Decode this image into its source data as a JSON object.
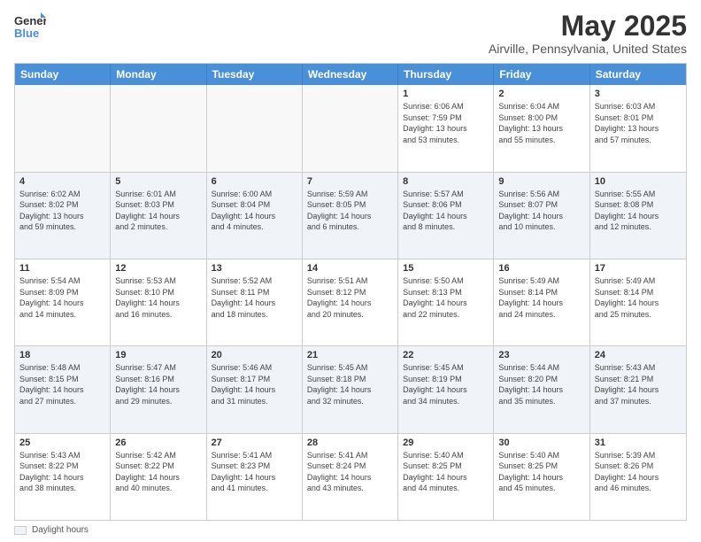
{
  "logo": {
    "line1": "General",
    "line2": "Blue"
  },
  "header": {
    "title": "May 2025",
    "subtitle": "Airville, Pennsylvania, United States"
  },
  "days": [
    "Sunday",
    "Monday",
    "Tuesday",
    "Wednesday",
    "Thursday",
    "Friday",
    "Saturday"
  ],
  "weeks": [
    [
      {
        "day": "",
        "text": ""
      },
      {
        "day": "",
        "text": ""
      },
      {
        "day": "",
        "text": ""
      },
      {
        "day": "",
        "text": ""
      },
      {
        "day": "1",
        "text": "Sunrise: 6:06 AM\nSunset: 7:59 PM\nDaylight: 13 hours\nand 53 minutes."
      },
      {
        "day": "2",
        "text": "Sunrise: 6:04 AM\nSunset: 8:00 PM\nDaylight: 13 hours\nand 55 minutes."
      },
      {
        "day": "3",
        "text": "Sunrise: 6:03 AM\nSunset: 8:01 PM\nDaylight: 13 hours\nand 57 minutes."
      }
    ],
    [
      {
        "day": "4",
        "text": "Sunrise: 6:02 AM\nSunset: 8:02 PM\nDaylight: 13 hours\nand 59 minutes."
      },
      {
        "day": "5",
        "text": "Sunrise: 6:01 AM\nSunset: 8:03 PM\nDaylight: 14 hours\nand 2 minutes."
      },
      {
        "day": "6",
        "text": "Sunrise: 6:00 AM\nSunset: 8:04 PM\nDaylight: 14 hours\nand 4 minutes."
      },
      {
        "day": "7",
        "text": "Sunrise: 5:59 AM\nSunset: 8:05 PM\nDaylight: 14 hours\nand 6 minutes."
      },
      {
        "day": "8",
        "text": "Sunrise: 5:57 AM\nSunset: 8:06 PM\nDaylight: 14 hours\nand 8 minutes."
      },
      {
        "day": "9",
        "text": "Sunrise: 5:56 AM\nSunset: 8:07 PM\nDaylight: 14 hours\nand 10 minutes."
      },
      {
        "day": "10",
        "text": "Sunrise: 5:55 AM\nSunset: 8:08 PM\nDaylight: 14 hours\nand 12 minutes."
      }
    ],
    [
      {
        "day": "11",
        "text": "Sunrise: 5:54 AM\nSunset: 8:09 PM\nDaylight: 14 hours\nand 14 minutes."
      },
      {
        "day": "12",
        "text": "Sunrise: 5:53 AM\nSunset: 8:10 PM\nDaylight: 14 hours\nand 16 minutes."
      },
      {
        "day": "13",
        "text": "Sunrise: 5:52 AM\nSunset: 8:11 PM\nDaylight: 14 hours\nand 18 minutes."
      },
      {
        "day": "14",
        "text": "Sunrise: 5:51 AM\nSunset: 8:12 PM\nDaylight: 14 hours\nand 20 minutes."
      },
      {
        "day": "15",
        "text": "Sunrise: 5:50 AM\nSunset: 8:13 PM\nDaylight: 14 hours\nand 22 minutes."
      },
      {
        "day": "16",
        "text": "Sunrise: 5:49 AM\nSunset: 8:14 PM\nDaylight: 14 hours\nand 24 minutes."
      },
      {
        "day": "17",
        "text": "Sunrise: 5:49 AM\nSunset: 8:14 PM\nDaylight: 14 hours\nand 25 minutes."
      }
    ],
    [
      {
        "day": "18",
        "text": "Sunrise: 5:48 AM\nSunset: 8:15 PM\nDaylight: 14 hours\nand 27 minutes."
      },
      {
        "day": "19",
        "text": "Sunrise: 5:47 AM\nSunset: 8:16 PM\nDaylight: 14 hours\nand 29 minutes."
      },
      {
        "day": "20",
        "text": "Sunrise: 5:46 AM\nSunset: 8:17 PM\nDaylight: 14 hours\nand 31 minutes."
      },
      {
        "day": "21",
        "text": "Sunrise: 5:45 AM\nSunset: 8:18 PM\nDaylight: 14 hours\nand 32 minutes."
      },
      {
        "day": "22",
        "text": "Sunrise: 5:45 AM\nSunset: 8:19 PM\nDaylight: 14 hours\nand 34 minutes."
      },
      {
        "day": "23",
        "text": "Sunrise: 5:44 AM\nSunset: 8:20 PM\nDaylight: 14 hours\nand 35 minutes."
      },
      {
        "day": "24",
        "text": "Sunrise: 5:43 AM\nSunset: 8:21 PM\nDaylight: 14 hours\nand 37 minutes."
      }
    ],
    [
      {
        "day": "25",
        "text": "Sunrise: 5:43 AM\nSunset: 8:22 PM\nDaylight: 14 hours\nand 38 minutes."
      },
      {
        "day": "26",
        "text": "Sunrise: 5:42 AM\nSunset: 8:22 PM\nDaylight: 14 hours\nand 40 minutes."
      },
      {
        "day": "27",
        "text": "Sunrise: 5:41 AM\nSunset: 8:23 PM\nDaylight: 14 hours\nand 41 minutes."
      },
      {
        "day": "28",
        "text": "Sunrise: 5:41 AM\nSunset: 8:24 PM\nDaylight: 14 hours\nand 43 minutes."
      },
      {
        "day": "29",
        "text": "Sunrise: 5:40 AM\nSunset: 8:25 PM\nDaylight: 14 hours\nand 44 minutes."
      },
      {
        "day": "30",
        "text": "Sunrise: 5:40 AM\nSunset: 8:25 PM\nDaylight: 14 hours\nand 45 minutes."
      },
      {
        "day": "31",
        "text": "Sunrise: 5:39 AM\nSunset: 8:26 PM\nDaylight: 14 hours\nand 46 minutes."
      }
    ]
  ],
  "footer": {
    "legend_label": "Daylight hours"
  }
}
